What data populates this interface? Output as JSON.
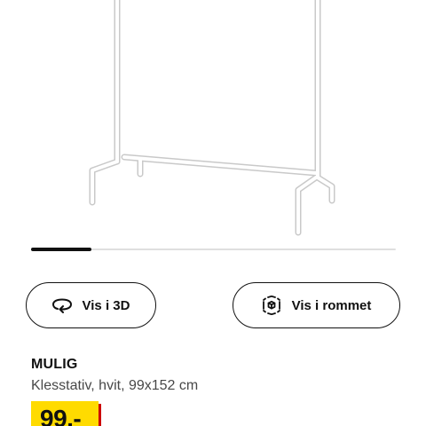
{
  "product": {
    "image_alt": "MULIG clothes rack",
    "name": "MULIG",
    "description": "Klesstativ, hvit, 99x152 cm",
    "price": "99,-"
  },
  "carousel": {
    "progress": 0.165
  },
  "actions": {
    "view_3d_label": "Vis i 3D",
    "view_3d_icon": "rotate-3d-icon",
    "view_room_label": "Vis i rommet",
    "view_room_icon": "ar-cube-icon"
  },
  "colors": {
    "price_background": "#ffdb00",
    "price_accent": "#cc0008",
    "text": "#111111",
    "secondary_text": "#484848"
  }
}
